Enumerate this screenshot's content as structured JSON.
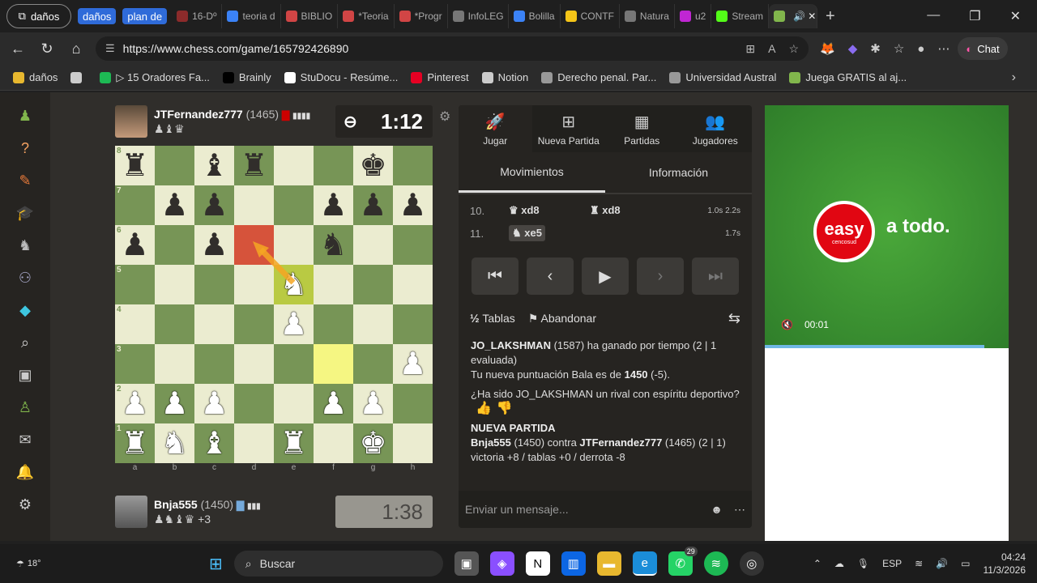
{
  "browser": {
    "profile_label": "daños",
    "tab_groups": [
      {
        "label": "daños",
        "color": "#2f6bd9"
      },
      {
        "label": "plan de",
        "color": "#2f6bd9"
      }
    ],
    "tabs": [
      {
        "label": "16-Dº",
        "color": "#8c2b2b"
      },
      {
        "label": "teoria d",
        "color": "#3b82f6"
      },
      {
        "label": "BIBLIO",
        "color": "#d14545"
      },
      {
        "label": "*Teoria",
        "color": "#d14545"
      },
      {
        "label": "*Progr",
        "color": "#d14545"
      },
      {
        "label": "InfoLEG",
        "color": "#777777"
      },
      {
        "label": "Bolilla",
        "color": "#3b82f6"
      },
      {
        "label": "CONTF",
        "color": "#f5c518"
      },
      {
        "label": "Natura",
        "color": "#777777"
      },
      {
        "label": "u2",
        "color": "#c026d3"
      },
      {
        "label": "Stream",
        "color": "#53fc18"
      },
      {
        "label": "",
        "color": "#81b64c",
        "active": true
      }
    ],
    "url": "https://www.chess.com/game/165792426890",
    "chat_label": "Chat",
    "bookmarks": [
      {
        "label": "daños",
        "icon": "folder-icon"
      },
      {
        "label": "",
        "icon": "reader-icon"
      },
      {
        "label": "▷ 15 Oradores Fa...",
        "icon": "green-icon"
      },
      {
        "label": "Brainly",
        "icon": "brainly-icon"
      },
      {
        "label": "StuDocu - Resúme...",
        "icon": "studocu-icon"
      },
      {
        "label": "Pinterest",
        "icon": "pinterest-icon"
      },
      {
        "label": "Notion",
        "icon": "bookmark-icon"
      },
      {
        "label": "Derecho penal. Par...",
        "icon": "site-icon"
      },
      {
        "label": "Universidad Austral",
        "icon": "site-icon"
      },
      {
        "label": "Juega GRATIS al aj...",
        "icon": "chess-icon"
      }
    ]
  },
  "game": {
    "top_player": {
      "name": "JTFernandez777",
      "rating": "(1465)",
      "captured": "♟♝♛",
      "clock": "1:12"
    },
    "bottom_player": {
      "name": "Bnja555",
      "rating": "(1450)",
      "captured": "♟♞♝♛ +3",
      "clock": "1:38"
    },
    "ranks": [
      "8",
      "7",
      "6",
      "5",
      "4",
      "3",
      "2",
      "1"
    ],
    "files": [
      "a",
      "b",
      "c",
      "d",
      "e",
      "f",
      "g",
      "h"
    ],
    "board": [
      [
        "bR",
        "",
        "bB",
        "bR",
        "",
        "",
        "bK",
        ""
      ],
      [
        "",
        "bP",
        "bP",
        "",
        "",
        "bP",
        "bP",
        "bP"
      ],
      [
        "bP",
        "",
        "bP",
        "",
        "",
        "bN",
        "",
        ""
      ],
      [
        "",
        "",
        "",
        "",
        "wN",
        "",
        "",
        ""
      ],
      [
        "",
        "",
        "",
        "",
        "wP",
        "",
        "",
        ""
      ],
      [
        "",
        "",
        "",
        "",
        "",
        "",
        "",
        "wP"
      ],
      [
        "wP",
        "wP",
        "wP",
        "",
        "",
        "wP",
        "wP",
        ""
      ],
      [
        "wR",
        "wN",
        "wB",
        "",
        "wR",
        "",
        "wK",
        ""
      ]
    ],
    "highlights": {
      "red": "d6",
      "yellow": [
        "e5",
        "f3"
      ]
    }
  },
  "panel": {
    "tabs": [
      {
        "label": "Jugar",
        "icon": "rocket-icon"
      },
      {
        "label": "Nueva Partida",
        "icon": "plus-icon"
      },
      {
        "label": "Partidas",
        "icon": "board-icon"
      },
      {
        "label": "Jugadores",
        "icon": "players-icon"
      }
    ],
    "subtabs": [
      "Movimientos",
      "Información"
    ],
    "moves": [
      {
        "num": "10.",
        "white": "♛ xd8",
        "black": "♜ xd8",
        "times": [
          "1.0s",
          "2.2s"
        ]
      },
      {
        "num": "11.",
        "white": "♞ xe5",
        "black": "",
        "times": [
          "1.7s"
        ]
      }
    ],
    "actions": {
      "draw": "Tablas",
      "resign": "Abandonar",
      "half": "½"
    },
    "chat": {
      "line1_name": "JO_LAKSHMAN",
      "line1_rest": " (1587) ha ganado por tiempo (2 | 1 evaluada)",
      "line2_pre": "Tu nueva puntuación Bala es de ",
      "line2_bold": "1450",
      "line2_post": " (-5).",
      "line3_pre": "¿Ha sido ",
      "line3_name": "JO_LAKSHMAN",
      "line3_post": " un rival con espíritu deportivo?",
      "new_game": "NUEVA PARTIDA",
      "line4_a": "Bnja555",
      "line4_b": " (1450) contra ",
      "line4_c": "JTFernandez777",
      "line4_d": " (1465) (2 | 1)",
      "line5": "victoria +8 / tablas +0 / derrota -8"
    },
    "message_placeholder": "Enviar un mensaje..."
  },
  "ad": {
    "brand": "easy",
    "brand_sub": "cencosud",
    "tagline": "a todo.",
    "time": "00:01",
    "color": "#e10612",
    "progress": 0.9
  },
  "taskbar": {
    "temp": "18°",
    "search": "Buscar",
    "whatsapp_badge": "29",
    "lang": "ESP",
    "time": "04:24",
    "date": "11/3/2026"
  }
}
